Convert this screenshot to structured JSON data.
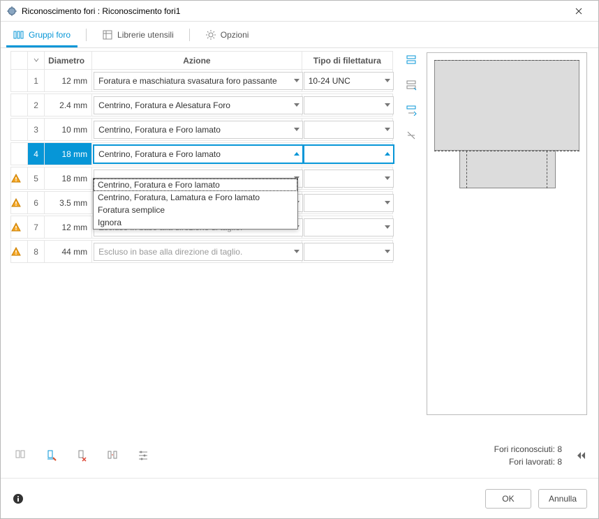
{
  "window": {
    "title": "Riconoscimento fori : Riconoscimento fori1"
  },
  "tabs": {
    "groups": "Gruppi foro",
    "libraries": "Librerie utensili",
    "options": "Opzioni"
  },
  "table": {
    "headers": {
      "diametro": "Diametro",
      "azione": "Azione",
      "filettatura": "Tipo di filettatura"
    },
    "rows": [
      {
        "n": "1",
        "diam": "12 mm",
        "action": "Foratura e maschiatura svasatura foro passante",
        "thread": "10-24 UNC",
        "warn": false,
        "muted": false
      },
      {
        "n": "2",
        "diam": "2.4 mm",
        "action": "Centrino, Foratura e Alesatura Foro",
        "thread": "",
        "warn": false,
        "muted": false
      },
      {
        "n": "3",
        "diam": "10 mm",
        "action": "Centrino, Foratura e Foro lamato",
        "thread": "",
        "warn": false,
        "muted": false
      },
      {
        "n": "4",
        "diam": "18 mm",
        "action": "Centrino, Foratura e Foro lamato",
        "thread": "",
        "warn": false,
        "muted": false,
        "selected": true
      },
      {
        "n": "5",
        "diam": "18 mm",
        "action": "",
        "thread": "",
        "warn": true,
        "muted": false
      },
      {
        "n": "6",
        "diam": "3.5 mm",
        "action": "",
        "thread": "",
        "warn": true,
        "muted": false
      },
      {
        "n": "7",
        "diam": "12 mm",
        "action": "Escluso in base alla direzione di taglio.",
        "thread": "",
        "warn": true,
        "muted": true
      },
      {
        "n": "8",
        "diam": "44 mm",
        "action": "Escluso in base alla direzione di taglio.",
        "thread": "",
        "warn": true,
        "muted": true
      }
    ]
  },
  "dropdown": {
    "options": [
      "Centrino, Foratura e Foro lamato",
      "Centrino, Foratura, Lamatura e Foro lamato",
      "Foratura semplice",
      "Ignora"
    ]
  },
  "status": {
    "recognized_label": "Fori riconosciuti:",
    "recognized_value": "8",
    "machined_label": "Fori lavorati:",
    "machined_value": "8"
  },
  "footer": {
    "ok": "OK",
    "cancel": "Annulla"
  }
}
